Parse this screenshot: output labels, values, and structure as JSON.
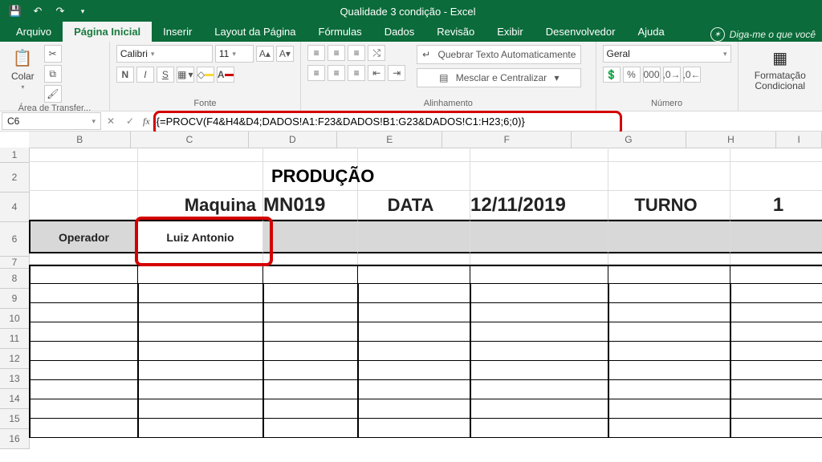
{
  "title": "Qualidade 3 condição - Excel",
  "qat_icons": [
    "save-icon",
    "undo-icon",
    "redo-icon",
    "dropdown-icon"
  ],
  "tabs": [
    "Arquivo",
    "Página Inicial",
    "Inserir",
    "Layout da Página",
    "Fórmulas",
    "Dados",
    "Revisão",
    "Exibir",
    "Desenvolvedor",
    "Ajuda"
  ],
  "active_tab": "Página Inicial",
  "tell_me": "Diga-me o que você",
  "ribbon": {
    "clipboard": {
      "paste": "Colar",
      "label": "Área de Transfer..."
    },
    "font": {
      "name": "Calibri",
      "size": "11",
      "label": "Fonte",
      "bold": "N",
      "italic": "I",
      "underline": "S"
    },
    "align": {
      "wrap": "Quebrar Texto Automaticamente",
      "merge": "Mesclar e Centralizar",
      "label": "Alinhamento"
    },
    "number": {
      "format": "Geral",
      "label": "Número"
    },
    "styles": {
      "cf": "Formatação Condicional",
      "label": ""
    }
  },
  "namebox": "C6",
  "formula": "{=PROCV(F4&H4&D4;DADOS!A1:F23&DADOS!B1:G23&DADOS!C1:H23;6;0)}",
  "columns": [
    "B",
    "C",
    "D",
    "E",
    "F",
    "G",
    "H",
    "I"
  ],
  "row_numbers": [
    "1",
    "2",
    "4",
    "6",
    "7",
    "8",
    "9",
    "10",
    "11",
    "12",
    "13",
    "14",
    "15",
    "16"
  ],
  "sheet": {
    "title": "PRODUÇÃO",
    "r4": {
      "maquina_l": "Maquina",
      "maquina_v": "MN019",
      "data_l": "DATA",
      "data_v": "12/11/2019",
      "turno_l": "TURNO",
      "turno_v": "1"
    },
    "r6": {
      "operador_l": "Operador",
      "operador_v": "Luiz Antonio"
    }
  }
}
